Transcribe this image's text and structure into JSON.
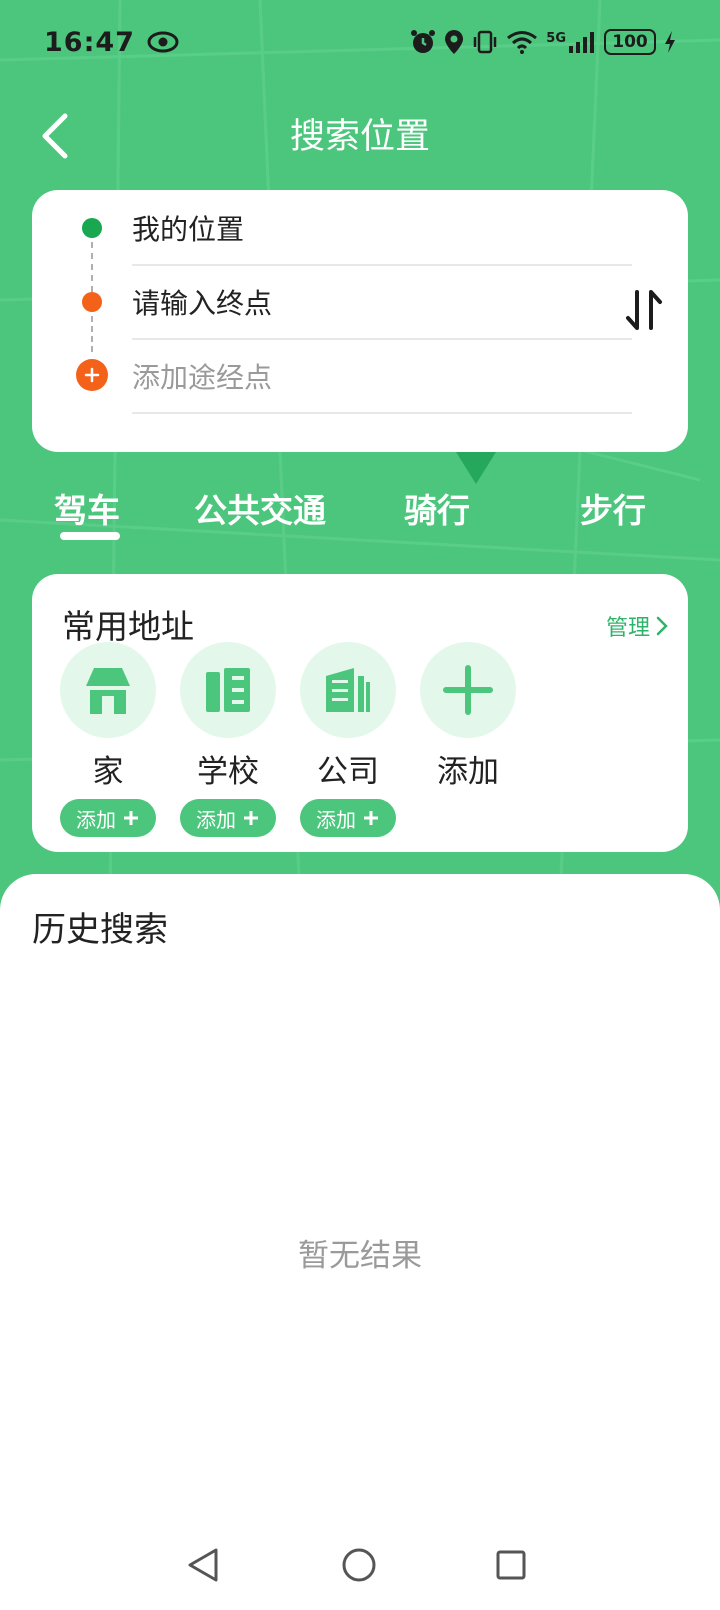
{
  "status": {
    "time": "16:47",
    "network": "5G",
    "battery": "100"
  },
  "header": {
    "title": "搜索位置"
  },
  "route": {
    "start": "我的位置",
    "end_placeholder": "请输入终点",
    "waypoint_placeholder": "添加途经点"
  },
  "modes": [
    {
      "label": "驾车",
      "active": true
    },
    {
      "label": "公共交通",
      "active": false
    },
    {
      "label": "骑行",
      "active": false
    },
    {
      "label": "步行",
      "active": false
    }
  ],
  "favorites": {
    "title": "常用地址",
    "manage_label": "管理",
    "items": [
      {
        "label": "家",
        "add_label": "添加",
        "icon": "home-icon"
      },
      {
        "label": "学校",
        "add_label": "添加",
        "icon": "school-icon"
      },
      {
        "label": "公司",
        "add_label": "添加",
        "icon": "company-icon"
      },
      {
        "label": "添加",
        "icon": "plus-icon"
      }
    ]
  },
  "history": {
    "title": "历史搜索",
    "empty": "暂无结果"
  },
  "colors": {
    "primary": "#4cc67d",
    "start_dot": "#19a84f",
    "end_dot": "#f4621a",
    "icon_bg": "#e3f8ea",
    "accent_text": "#2eb46a"
  }
}
